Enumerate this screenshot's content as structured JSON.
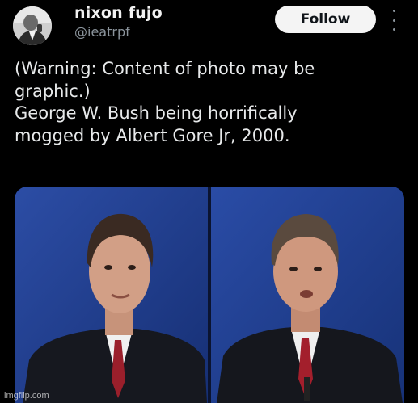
{
  "author": {
    "display_name": "nixon fujo",
    "handle": "@ieatrpf",
    "avatar_icon": "profile-photo-avatar"
  },
  "actions": {
    "follow_label": "Follow",
    "more_icon": "more-vertical-icon"
  },
  "tweet": {
    "text_lines": [
      "(Warning: Content of photo may be",
      "graphic.)",
      "George W. Bush being horrifically",
      "mogged by Albert Gore Jr, 2000."
    ]
  },
  "media": {
    "description_icon": "debate-photo",
    "background_color": "#1f3c8c"
  },
  "watermark": "imgflip.com"
}
